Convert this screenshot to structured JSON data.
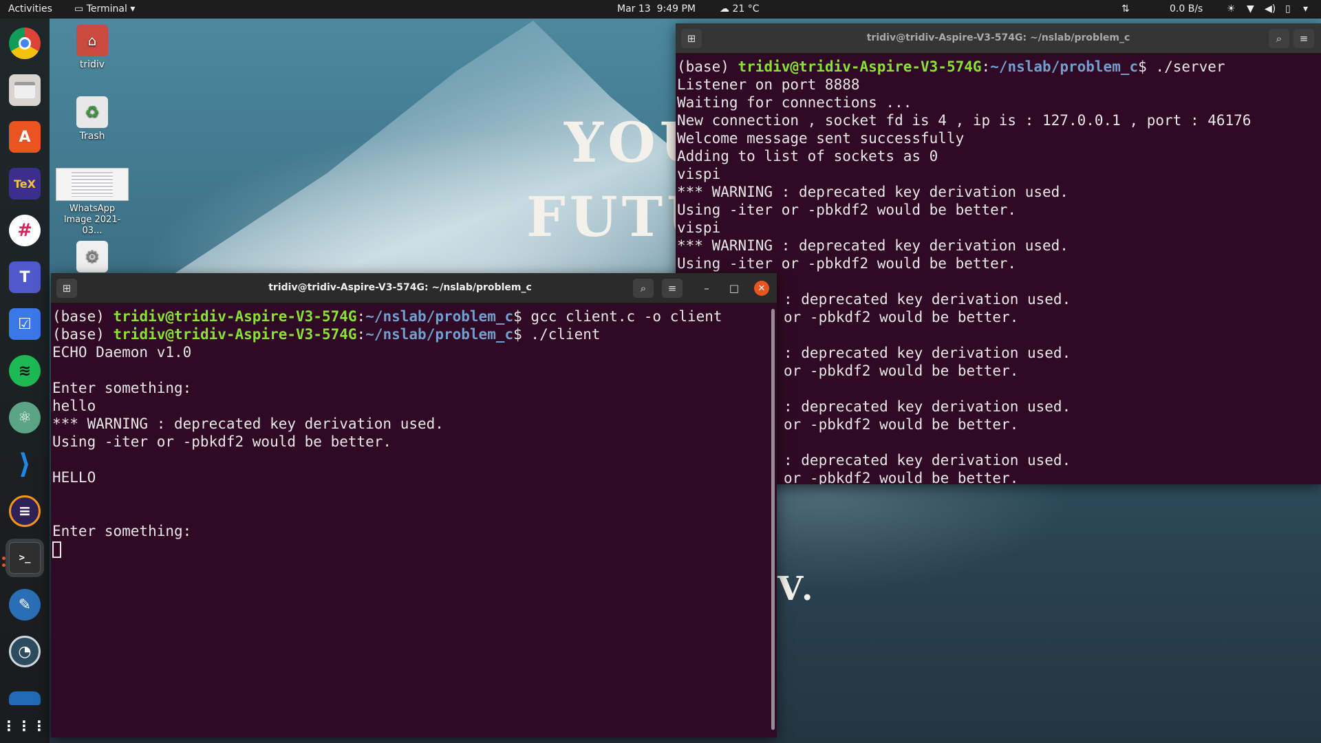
{
  "topbar": {
    "activities": "Activities",
    "app_menu": "Terminal",
    "date": "Mar 13",
    "time": "9:49 PM",
    "weather": "21 °C",
    "net_speed": "0.0 B/s"
  },
  "wallpaper": {
    "text1": "YOU",
    "text2": "FUTU",
    "text3": "V."
  },
  "desktop": {
    "icons": [
      {
        "label": "tridiv"
      },
      {
        "label": "Trash"
      },
      {
        "label": "WhatsApp Image 2021-03..."
      }
    ]
  },
  "dock": {
    "items": [
      {
        "name": "chrome",
        "glyph": "",
        "color": "#db4437"
      },
      {
        "name": "files",
        "glyph": "",
        "color": "#d8d4cf"
      },
      {
        "name": "software",
        "glyph": "A",
        "color": "#e95420"
      },
      {
        "name": "texstudio",
        "glyph": "TeX",
        "color": "#3b2e8c"
      },
      {
        "name": "slack",
        "glyph": "#",
        "color": "#ffffff"
      },
      {
        "name": "teams",
        "glyph": "T",
        "color": "#5059c9"
      },
      {
        "name": "tasks",
        "glyph": "☑",
        "color": "#3b78e7"
      },
      {
        "name": "spotify",
        "glyph": "≋",
        "color": "#1db954"
      },
      {
        "name": "atom",
        "glyph": "⚛",
        "color": "#5ba586"
      },
      {
        "name": "vscode",
        "glyph": "⟩",
        "color": "#1e88e5"
      },
      {
        "name": "eclipse",
        "glyph": "≡",
        "color": "#2c2255"
      },
      {
        "name": "terminal",
        "glyph": ">_",
        "color": "#2f2f2f"
      },
      {
        "name": "gimp",
        "glyph": "✎",
        "color": "#5a5a6e"
      },
      {
        "name": "stacer",
        "glyph": "◔",
        "color": "#2d4b5f"
      },
      {
        "name": "drive",
        "glyph": "",
        "color": "#1f6bb5"
      }
    ],
    "show_apps": "⋮⋮⋮"
  },
  "server_window": {
    "title": "tridiv@tridiv-Aspire-V3-574G: ~/nslab/problem_c",
    "prompt_base": "(base) ",
    "prompt_user": "tridiv@tridiv-Aspire-V3-574G",
    "prompt_sep": ":",
    "prompt_path": "~/nslab/problem_c",
    "prompt_dollar": "$ ",
    "command": "./server",
    "lines": [
      "Listener on port 8888",
      "Waiting for connections ...",
      "New connection , socket fd is 4 , ip is : 127.0.0.1 , port : 46176",
      "Welcome message sent successfully",
      "Adding to list of sockets as 0",
      "vispi",
      "*** WARNING : deprecated key derivation used.",
      "Using -iter or -pbkdf2 would be better.",
      "vispi",
      "*** WARNING : deprecated key derivation used.",
      "Using -iter or -pbkdf2 would be better.",
      "",
      ": deprecated key derivation used.",
      "or -pbkdf2 would be better.",
      "",
      ": deprecated key derivation used.",
      "or -pbkdf2 would be better.",
      "",
      ": deprecated key derivation used.",
      "or -pbkdf2 would be better.",
      "",
      ": deprecated key derivation used.",
      "or -pbkdf2 would be better."
    ]
  },
  "client_window": {
    "title": "tridiv@tridiv-Aspire-V3-574G: ~/nslab/problem_c",
    "prompt_base": "(base) ",
    "prompt_user": "tridiv@tridiv-Aspire-V3-574G",
    "prompt_sep": ":",
    "prompt_path": "~/nslab/problem_c",
    "prompt_dollar": "$ ",
    "cmd1": "gcc client.c -o client",
    "cmd2": "./client",
    "lines": [
      "ECHO Daemon v1.0",
      "",
      "Enter something:",
      "hello",
      "*** WARNING : deprecated key derivation used.",
      "Using -iter or -pbkdf2 would be better.",
      "",
      "HELLO",
      "",
      "",
      "Enter something:"
    ]
  }
}
